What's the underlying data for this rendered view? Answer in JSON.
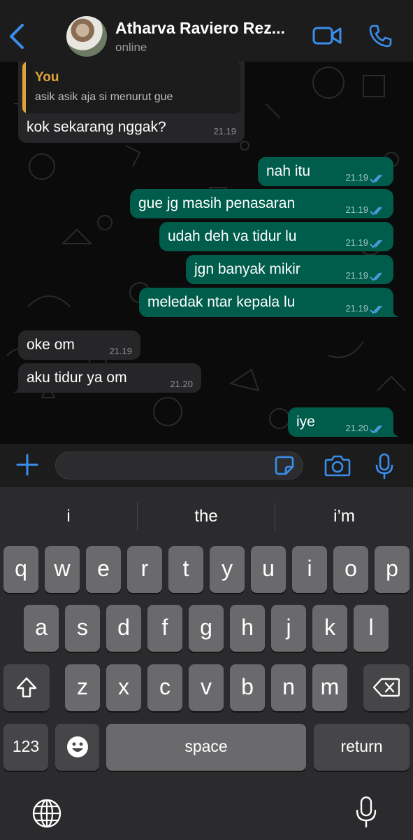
{
  "header": {
    "contact_name": "Atharva Raviero Rez...",
    "status": "online",
    "accent": "#3a8eea"
  },
  "chat": {
    "reply": {
      "quote_author": "You",
      "quote_text": "asik asik aja si menurut gue",
      "text": "kok sekarang nggak?",
      "time": "21.19"
    },
    "messages": [
      {
        "dir": "out",
        "text": "nah itu",
        "time": "21.19",
        "read": true
      },
      {
        "dir": "out",
        "text": "gue jg masih penasaran",
        "time": "21.19",
        "read": true
      },
      {
        "dir": "out",
        "text": "udah deh va tidur lu",
        "time": "21.19",
        "read": true
      },
      {
        "dir": "out",
        "text": "jgn banyak mikir",
        "time": "21.19",
        "read": true
      },
      {
        "dir": "out",
        "text": "meledak ntar kepala lu",
        "time": "21.19",
        "read": true
      },
      {
        "dir": "in",
        "text": "oke om",
        "time": "21.19"
      },
      {
        "dir": "in",
        "text": "aku tidur ya om",
        "time": "21.20"
      },
      {
        "dir": "out",
        "text": "iye",
        "time": "21.20",
        "read": true
      }
    ]
  },
  "input": {
    "placeholder": ""
  },
  "keyboard": {
    "suggestions": [
      "i",
      "the",
      "i’m"
    ],
    "row1": [
      "q",
      "w",
      "e",
      "r",
      "t",
      "y",
      "u",
      "i",
      "o",
      "p"
    ],
    "row2": [
      "a",
      "s",
      "d",
      "f",
      "g",
      "h",
      "j",
      "k",
      "l"
    ],
    "row3": [
      "z",
      "x",
      "c",
      "v",
      "b",
      "n",
      "m"
    ],
    "numbers_label": "123",
    "space_label": "space",
    "return_label": "return"
  }
}
